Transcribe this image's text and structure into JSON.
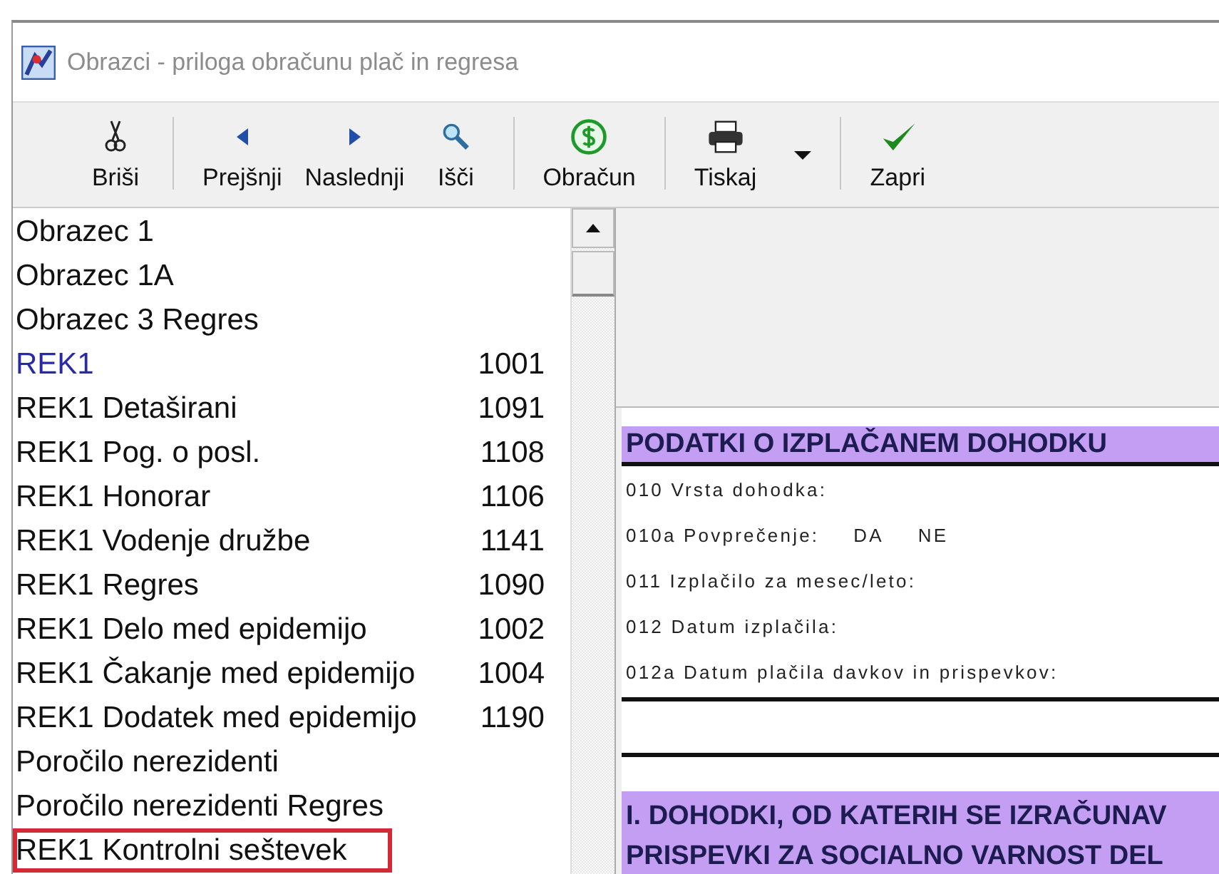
{
  "window": {
    "title": "Obrazci - priloga obračunu plač in regresa"
  },
  "toolbar": {
    "groups": [
      [
        {
          "label": "Briši"
        }
      ],
      [
        {
          "label": "Prejšnji"
        },
        {
          "label": "Naslednji"
        },
        {
          "label": "Išči"
        }
      ],
      [
        {
          "label": "Obračun"
        }
      ],
      [
        {
          "label": "Tiskaj",
          "has_dropdown": true
        }
      ],
      [
        {
          "label": "Zapri"
        }
      ]
    ]
  },
  "form_list": {
    "items": [
      {
        "name": "Obrazec 1",
        "selected": false,
        "marked": false
      },
      {
        "name": "Obrazec 1A",
        "selected": false,
        "marked": false
      },
      {
        "name": "Obrazec 3 Regres",
        "selected": false,
        "marked": false
      },
      {
        "name": "REK1",
        "code": "1001",
        "selected": true,
        "marked": false
      },
      {
        "name": "REK1 Detaširani",
        "code": "1091",
        "selected": false,
        "marked": false
      },
      {
        "name": "REK1 Pog. o posl.",
        "code": "1108",
        "selected": false,
        "marked": false
      },
      {
        "name": "REK1 Honorar",
        "code": "1106",
        "selected": false,
        "marked": false
      },
      {
        "name": "REK1 Vodenje družbe",
        "code": "1141",
        "selected": false,
        "marked": false
      },
      {
        "name": "REK1 Regres",
        "code": "1090",
        "selected": false,
        "marked": false
      },
      {
        "name": "REK1 Delo med epidemijo",
        "code": "1002",
        "selected": false,
        "marked": false
      },
      {
        "name": "REK1 Čakanje med epidemijo",
        "code": "1004",
        "selected": false,
        "marked": false
      },
      {
        "name": "REK1 Dodatek med epidemijo",
        "code": "1190",
        "selected": false,
        "marked": false
      },
      {
        "name": "Poročilo nerezidenti",
        "selected": false,
        "marked": false
      },
      {
        "name": "Poročilo nerezidenti Regres",
        "selected": false,
        "marked": false
      },
      {
        "name": "REK1 Kontrolni seštevek",
        "selected": false,
        "marked": true
      }
    ]
  },
  "document": {
    "sections": [
      {
        "heading": [
          "PODATKI O IZPLAČANEM DOHODKU"
        ],
        "fields": [
          {
            "code": "010",
            "label": "Vrsta dohodka:"
          },
          {
            "code": "010a",
            "label": "Povprečenje:",
            "options": [
              "DA",
              "NE"
            ]
          },
          {
            "code": "011",
            "label": "Izplačilo za mesec/leto:"
          },
          {
            "code": "012",
            "label": "Datum izplačila:"
          },
          {
            "code": "012a",
            "label": "Datum plačila davkov in prispevkov:"
          }
        ]
      },
      {
        "heading": [
          "I. DOHODKI, OD KATERIH SE IZRAČUNAV",
          "PRISPEVKI ZA SOCIALNO VARNOST DEL"
        ]
      }
    ]
  }
}
